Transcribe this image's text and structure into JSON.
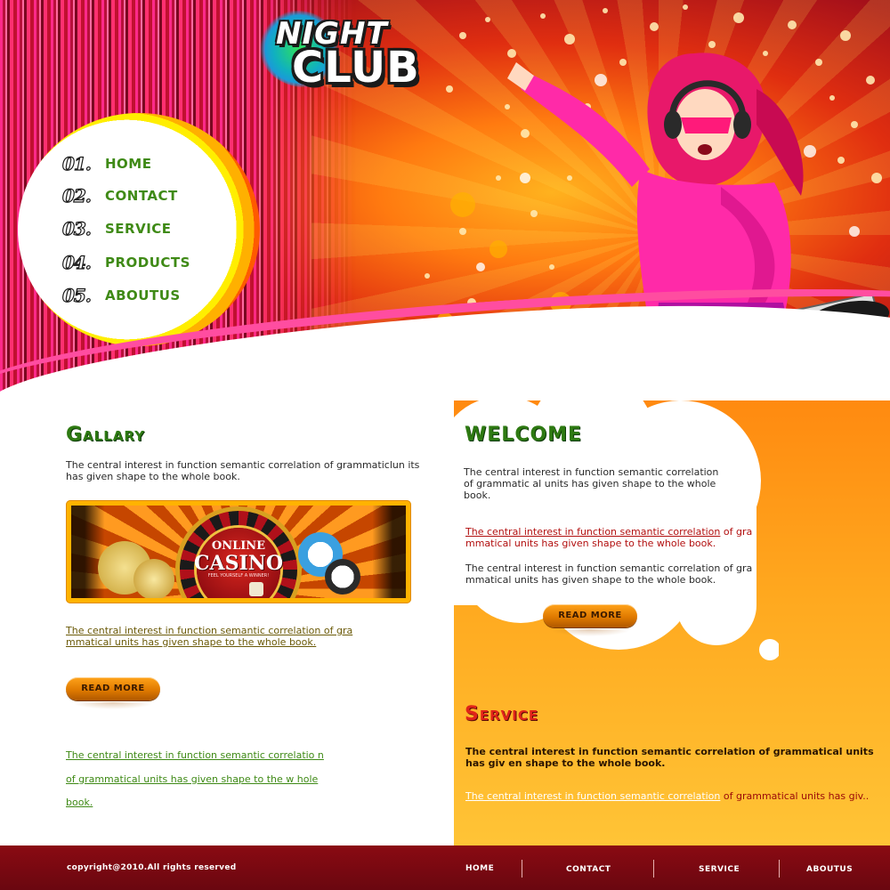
{
  "logo": {
    "line1": "NIGHT",
    "line2": "CLUB"
  },
  "nav": {
    "items": [
      {
        "num": "01.",
        "label": "HOME"
      },
      {
        "num": "02.",
        "label": "CONTACT"
      },
      {
        "num": "03.",
        "label": "SERVICE"
      },
      {
        "num": "04.",
        "label": "PRODUCTS"
      },
      {
        "num": "05.",
        "label": "ABOUTUS"
      }
    ]
  },
  "gallery": {
    "title": "Gallary",
    "description": "The central interest in function semantic correlation of grammaticlun its has given shape to the whole book.",
    "banner": {
      "line1": "ONLINE",
      "line2": "CASINO",
      "tagline": "FEEL YOURSELF A WINNER!"
    },
    "link": "The central interest in function semantic correlation of gra mmatical units has given shape to the whole book.",
    "read_more": "READ MORE",
    "link2": "The central interest in function semantic correlatio n of grammatical units has given shape to the w hole book."
  },
  "welcome": {
    "title": "WELCOME",
    "description": "The central interest in function semantic correlation of grammatic al units has given shape to the whole book.",
    "red_link": "The central interest in function semantic correlation",
    "red_rest": " of gra mmatical units has given shape to the whole book.",
    "description2": "The central interest in function semantic correlation of gra mmatical units has given shape to the whole book.",
    "read_more": "READ MORE"
  },
  "service": {
    "title": "Service",
    "description": "The central interest in function semantic correlation of grammatical units has giv en shape to the whole book.",
    "link": "The central interest in function semantic correlation",
    "rest": " of grammatical units has giv.."
  },
  "footer": {
    "copyright": "copyright@2010.All rights reserved",
    "nav": [
      "HOME",
      "CONTACT",
      "SERVICE",
      "ABOUTUS"
    ]
  },
  "colors": {
    "nav_green": "#3f8a16",
    "title_green": "#2e7a12",
    "service_red": "#e0241a",
    "footer_bg": "#7a0810",
    "orange_panel": "#ffa91f"
  }
}
